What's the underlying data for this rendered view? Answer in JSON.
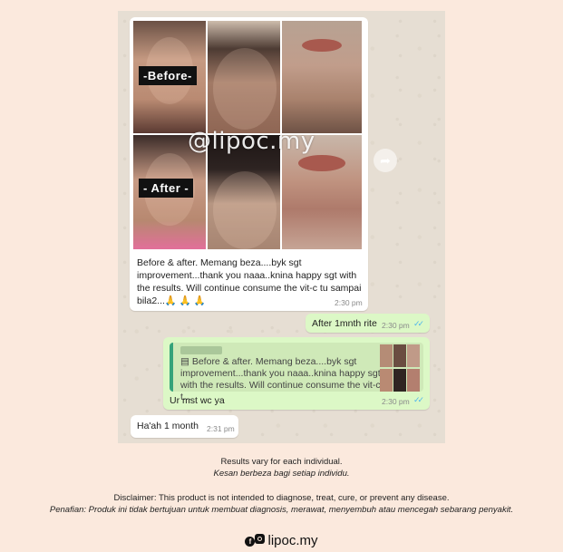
{
  "chat": {
    "photo_message": {
      "label_before": "-Before-",
      "label_after": "- After -",
      "watermark": "@lipoc.my",
      "caption": "Before & after. Memang beza....byk sgt improvement...thank you naaa..knina happy sgt with the results. Will continue consume the vit-c tu sampai bila2...🙏 🙏 🙏",
      "time": "2:30 pm"
    },
    "reply_1": {
      "text": "After 1mnth rite",
      "time": "2:30 pm"
    },
    "reply_2": {
      "quoted_text": "▤ Before & after. Memang beza....byk sgt improvement...thank you naaa..knina happy sgt with the results. Will continue consume the vit-c t...",
      "text": "Ur mst wc ya",
      "time": "2:30 pm"
    },
    "incoming_2": {
      "text": "Ha'ah 1 month",
      "time": "2:31 pm"
    }
  },
  "footer": {
    "results_en": "Results vary for each individual.",
    "results_ms": "Kesan berbeza bagi setiap individu.",
    "disclaimer_en": "Disclaimer: This product is not intended to diagnose, treat, cure, or prevent any disease.",
    "disclaimer_ms": "Penafian: Produk ini tidak bertujuan untuk membuat diagnosis, merawat, menyembuh atau mencegah sebarang penyakit.",
    "brand": "lipoc.my"
  },
  "icons": [
    "forward-icon",
    "double-check-icon",
    "facebook-icon",
    "instagram-icon",
    "image-icon"
  ],
  "colors": {
    "page_bg": "#fbe9dd",
    "chat_bg": "#e6ded3",
    "outgoing_bubble": "#dcf8c6",
    "read_ticks": "#4fb6ec"
  }
}
